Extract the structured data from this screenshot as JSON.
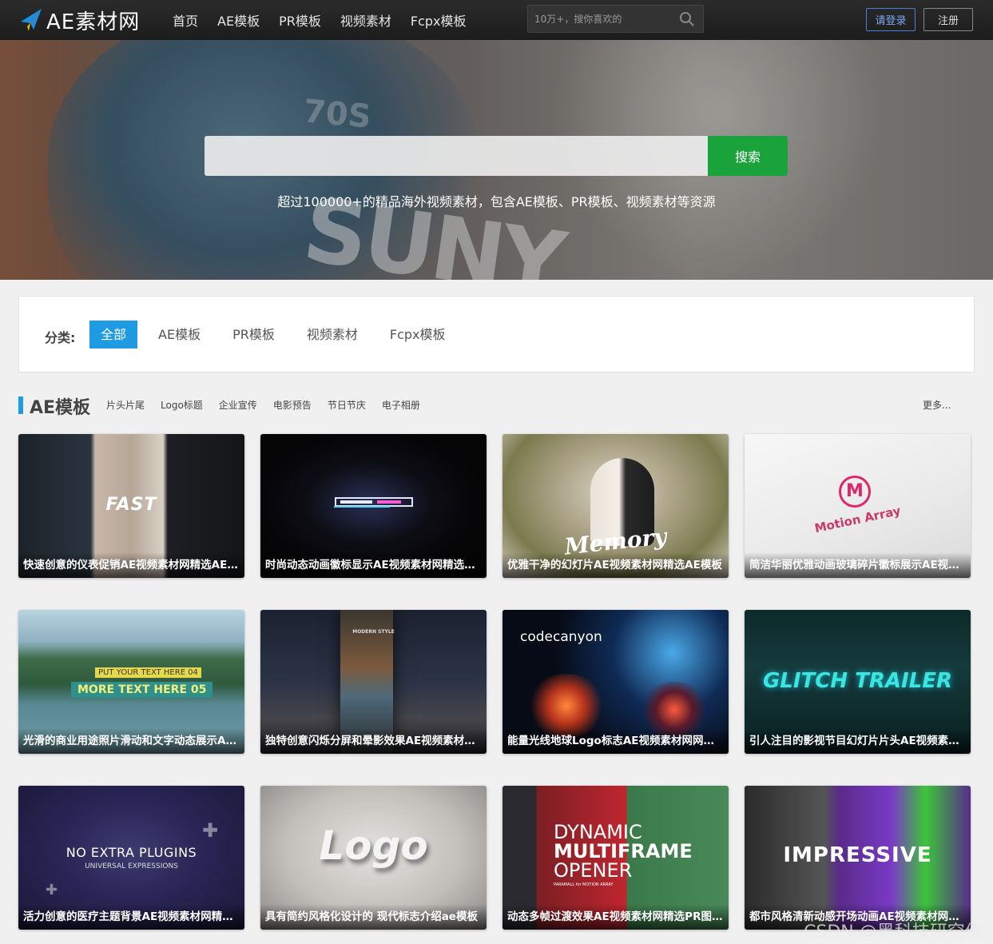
{
  "header": {
    "logo_text": "AE素材网",
    "nav": [
      "首页",
      "AE模板",
      "PR模板",
      "视频素材",
      "Fcpx模板"
    ],
    "search_placeholder": "10万+，搜你喜欢的",
    "login_label": "请登录",
    "register_label": "注册"
  },
  "hero": {
    "search_button": "搜索",
    "subtitle": "超过100000+的精品海外视频素材，包含AE模板、PR模板、视频素材等资源",
    "jersey_number": "70S",
    "jersey_text": "SUNY"
  },
  "category": {
    "label": "分类:",
    "items": [
      "全部",
      "AE模板",
      "PR模板",
      "视频素材",
      "Fcpx模板"
    ],
    "active": "全部"
  },
  "section": {
    "title": "AE模板",
    "tags": [
      "片头片尾",
      "Logo标题",
      "企业宣传",
      "电影预告",
      "节日节庆",
      "电子相册"
    ],
    "more": "更多..."
  },
  "cards": [
    {
      "caption": "快速创意的仪表促销AE视频素材网精选AE模板",
      "art": "FAST"
    },
    {
      "caption": "时尚动态动画徽标显示AE视频素材网精选AE模板",
      "art": ""
    },
    {
      "caption": "优雅干净的幻灯片AE视频素材网精选AE模板",
      "art": "Memory"
    },
    {
      "caption": "简洁华丽优雅动画玻璃碎片徽标展示AE视频素材",
      "art": "Motion Array",
      "art2": "M"
    },
    {
      "caption": "光滑的商业用途照片滑动和文字动态展示AE模板",
      "art": "MORE TEXT HERE 05",
      "art2": "PUT YOUR TEXT HERE 04"
    },
    {
      "caption": "独特创意闪烁分屏和晕影效果AE视频素材网精选",
      "art": "MODERN STYLE"
    },
    {
      "caption": "能量光线地球Logo标志AE视频素材网网精选",
      "art": "codecanyon"
    },
    {
      "caption": "引人注目的影视节目幻灯片片头AE视频素材网精选",
      "art": "GLITCH TRAILER"
    },
    {
      "caption": "活力创意的医疗主题背景AE视频素材网精选AE模板",
      "art": "NO EXTRA PLUGINS",
      "art2": "UNIVERSAL EXPRESSIONS"
    },
    {
      "caption": "具有简约风格化设计的 现代标志介绍ae模板",
      "art": "Logo"
    },
    {
      "caption": "动态多帧过渡效果AE视频素材网精选PR图文模板",
      "art": "DYNAMIC",
      "art2": "MULTIFRAME",
      "art3": "OPENER",
      "art4": "PARAMALL for MOTION ARRAY"
    },
    {
      "caption": "都市风格清新动感开场动画AE视频素材网精选AE模板",
      "art": "IMPRESSIVE"
    }
  ],
  "watermark": "CSDN @黑科技研究僧"
}
